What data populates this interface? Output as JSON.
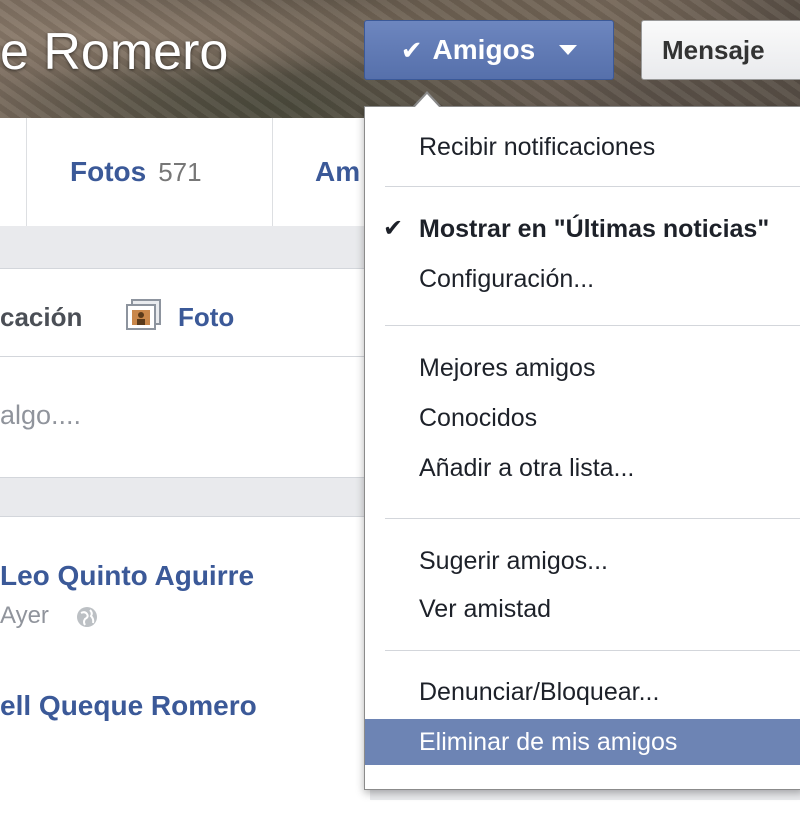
{
  "profile": {
    "name_partial": "e Romero"
  },
  "header": {
    "friends_button_label": "Amigos",
    "message_button_label": "Mensaje"
  },
  "tabs": {
    "photos_label": "Fotos",
    "photos_count": "571",
    "friends_label_partial": "Am"
  },
  "composer": {
    "status_tab_partial": "cación",
    "photo_tab_label": "Foto",
    "placeholder_partial": "algo...."
  },
  "feed": {
    "post1_author_partial": "Leo Quinto Aguirre",
    "post1_time": "Ayer",
    "post2_author_partial": "ell Queque Romero"
  },
  "friends_menu": {
    "items": [
      {
        "label": "Recibir notificaciones"
      },
      {
        "label": "Mostrar en \"Últimas noticias\"",
        "checked": true
      },
      {
        "label": "Configuración..."
      },
      {
        "label": "Mejores amigos"
      },
      {
        "label": "Conocidos"
      },
      {
        "label": "Añadir a otra lista..."
      },
      {
        "label": "Sugerir amigos..."
      },
      {
        "label": "Ver amistad"
      },
      {
        "label": "Denunciar/Bloquear..."
      },
      {
        "label": "Eliminar de mis amigos",
        "highlighted": true
      }
    ]
  },
  "colors": {
    "facebook_blue": "#3b5998",
    "highlight": "#6d84b4",
    "feed_background": "#e9eaed"
  }
}
